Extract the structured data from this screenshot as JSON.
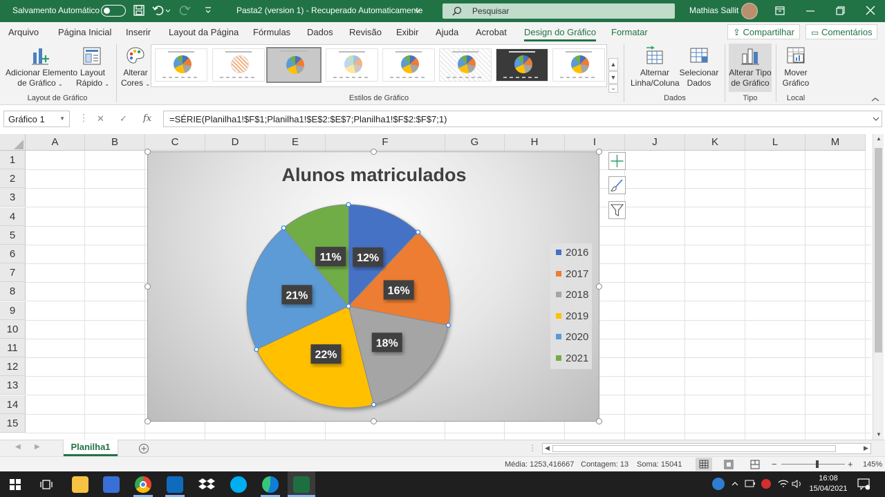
{
  "titlebar": {
    "autosave_label": "Salvamento Automático",
    "doc_title": "Pasta2 (version 1)  -  Recuperado Automaticamente",
    "search_placeholder": "Pesquisar",
    "user_name": "Mathias Sallit",
    "bg_color": "#217346"
  },
  "tabs": [
    "Arquivo",
    "Página Inicial",
    "Inserir",
    "Layout da Página",
    "Fórmulas",
    "Dados",
    "Revisão",
    "Exibir",
    "Ajuda",
    "Acrobat",
    "Design do Gráfico",
    "Formatar"
  ],
  "active_tab": "Design do Gráfico",
  "share_label": "Compartilhar",
  "comments_label": "Comentários",
  "ribbon": {
    "add_element_line1": "Adicionar Elemento",
    "add_element_line2": "de Gráfico",
    "quick_layout_line1": "Layout",
    "quick_layout_line2": "Rápido",
    "change_colors_line1": "Alterar",
    "change_colors_line2": "Cores",
    "switch_row_col_line1": "Alternar",
    "switch_row_col_line2": "Linha/Coluna",
    "select_data_line1": "Selecionar",
    "select_data_line2": "Dados",
    "change_type_line1": "Alterar Tipo",
    "change_type_line2": "de Gráfico",
    "move_chart_line1": "Mover",
    "move_chart_line2": "Gráfico",
    "group_layouts": "Layout de Gráfico",
    "group_styles": "Estilos de Gráfico",
    "group_data": "Dados",
    "group_type": "Tipo",
    "group_location": "Local"
  },
  "formula_bar": {
    "name_box": "Gráfico 1",
    "fx": "fx",
    "formula": "=SÉRIE(Planilha1!$F$1;Planilha1!$E$2:$E$7;Planilha1!$F$2:$F$7;1)"
  },
  "columns": [
    "A",
    "B",
    "C",
    "D",
    "E",
    "F",
    "G",
    "H",
    "I",
    "J",
    "K",
    "L",
    "M"
  ],
  "rows": [
    "1",
    "2",
    "3",
    "4",
    "5",
    "6",
    "7",
    "8",
    "9",
    "10",
    "11",
    "12",
    "13",
    "14",
    "15"
  ],
  "chart_data": {
    "type": "pie",
    "title": "Alunos matriculados",
    "categories": [
      "2016",
      "2017",
      "2018",
      "2019",
      "2020",
      "2021"
    ],
    "values": [
      12,
      16,
      18,
      22,
      21,
      11
    ],
    "labels": [
      "12%",
      "16%",
      "18%",
      "22%",
      "21%",
      "11%"
    ],
    "colors": [
      "#4472c4",
      "#ed7d31",
      "#a5a5a5",
      "#ffc000",
      "#5b9bd5",
      "#70ad47"
    ],
    "legend_position": "right"
  },
  "sheet": {
    "tab_name": "Planilha1"
  },
  "status": {
    "average": "Média: 1253,416667",
    "count": "Contagem: 13",
    "sum": "Soma: 15041",
    "zoom": "145%"
  },
  "taskbar": {
    "time": "16:08",
    "date": "15/04/2021"
  }
}
